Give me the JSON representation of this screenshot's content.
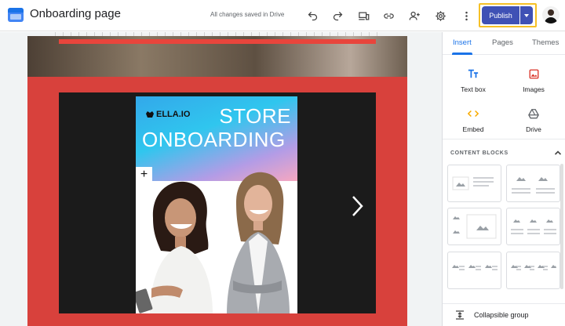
{
  "header": {
    "title": "Onboarding page",
    "save_status": "All changes saved in Drive",
    "publish_label": "Publish",
    "toolbar_icons": [
      "undo-icon",
      "redo-icon",
      "preview-devices-icon",
      "link-icon",
      "share-icon",
      "settings-icon",
      "more-vert-icon",
      "publish-dropdown-icon"
    ]
  },
  "slide": {
    "brand": "ELLA.IO",
    "headline_line1": "STORE",
    "headline_line2": "ONBOARDING",
    "add_label": "+"
  },
  "panel": {
    "tabs": [
      {
        "label": "Insert",
        "active": true
      },
      {
        "label": "Pages",
        "active": false
      },
      {
        "label": "Themes",
        "active": false
      }
    ],
    "insert_items": [
      {
        "label": "Text box",
        "icon": "text-box-icon"
      },
      {
        "label": "Images",
        "icon": "image-icon"
      },
      {
        "label": "Embed",
        "icon": "embed-icon"
      },
      {
        "label": "Drive",
        "icon": "drive-icon"
      }
    ],
    "content_blocks_title": "CONTENT BLOCKS",
    "collapsible_label": "Collapsible group"
  },
  "colors": {
    "publish": "#3f51b5",
    "highlight": "#f6c026",
    "accent": "#1a73e8",
    "page_background": "#d8413c",
    "carousel_background": "#1b1b1b"
  }
}
